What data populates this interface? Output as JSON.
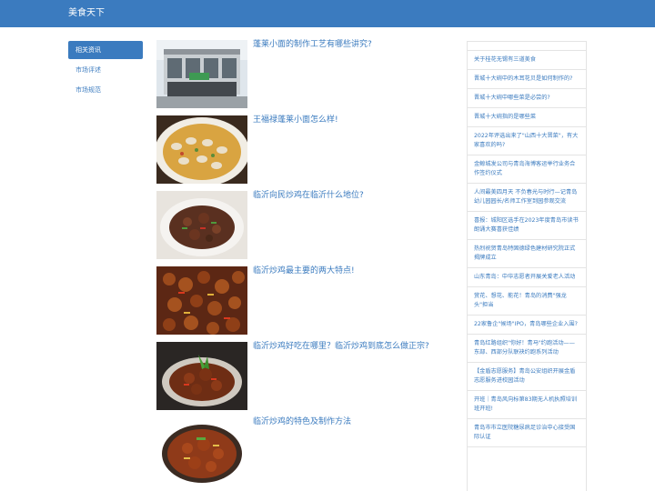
{
  "header": {
    "brand": "美食天下"
  },
  "sidenav": {
    "items": [
      {
        "label": "相关资讯",
        "active": true
      },
      {
        "label": "市场评述",
        "active": false
      },
      {
        "label": "市场规范",
        "active": false
      }
    ]
  },
  "articles": [
    {
      "title": "蓬莱小面的制作工艺有哪些讲究?"
    },
    {
      "title": "王福禄蓬莱小面怎么样!"
    },
    {
      "title": "临沂向民炒鸡在临沂什么地位?"
    },
    {
      "title": "临沂炒鸡最主要的两大特点!"
    },
    {
      "title": "临沂炒鸡好吃在哪里？临沂炒鸡到底怎么做正宗?"
    },
    {
      "title": "临沂炒鸡的特色及制作方法"
    }
  ],
  "sidebar": {
    "items": [
      "关于桂花无锡有三道美食",
      "晋城十大碗中的木耳花贝是如何制作的?",
      "晋城十大碗中哪些菜是必尝的?",
      "晋城十大碗指的是哪些菜",
      "2022年评选出来了\"山西十大晋菜\"，有大家喜欢的吗?",
      "金鲸城发公司与青岛海博客运举行业务合作签约仪式",
      "人间最美四月天 不负春光与时行—记青岛幼儿园园长/名师工作室到园参观交流",
      "喜报：城阳区选手在2023年度青岛市读书朗诵大赛喜获佳绩",
      "热烈祝贺青岛特固德绿色建材研究院正式揭牌成立",
      "山东青岛：中华志愿者开展关爱老人活动",
      "赏花、想花、能花！青岛的消费\"强龙头\"担当",
      "22家鲁企\"候场\"IPO，青岛哪些企业入围?",
      "青岛红路组织\"你好！青马\"约跑活动——东部、西部分队联袂约跑系列活动",
      "【金盾志愿服务】青岛公安组织开展金盾志愿服务进校园活动",
      "开班｜青岛风向标第83期无人机执照培训班开班!",
      "青岛市市立医院糖尿病足诊治中心接受国际认证"
    ]
  }
}
